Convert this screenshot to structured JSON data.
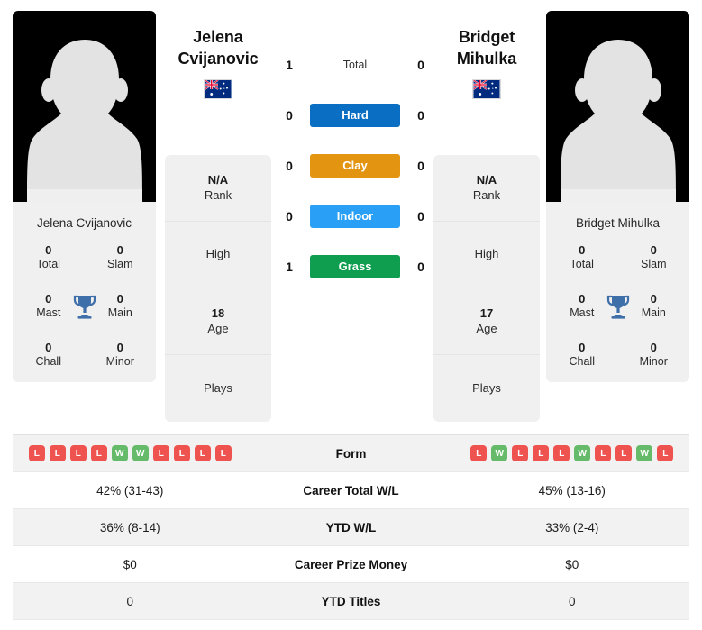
{
  "players": {
    "left": {
      "first_name": "Jelena",
      "last_name": "Cvijanovic",
      "full_name": "Jelena Cvijanovic",
      "flag": "australia-flag",
      "titles": {
        "total_value": "0",
        "total_label": "Total",
        "slam_value": "0",
        "slam_label": "Slam",
        "mast_value": "0",
        "mast_label": "Mast",
        "main_value": "0",
        "main_label": "Main",
        "chall_value": "0",
        "chall_label": "Chall",
        "minor_value": "0",
        "minor_label": "Minor"
      },
      "info": {
        "rank_value": "N/A",
        "rank_label": "Rank",
        "high_value": "",
        "high_label": "High",
        "age_value": "18",
        "age_label": "Age",
        "plays_value": "",
        "plays_label": "Plays"
      },
      "form": [
        "L",
        "L",
        "L",
        "L",
        "W",
        "W",
        "L",
        "L",
        "L",
        "L"
      ],
      "career_total_wl": "42% (31-43)",
      "ytd_wl": "36% (8-14)",
      "career_prize_money": "$0",
      "ytd_titles": "0"
    },
    "right": {
      "first_name": "Bridget",
      "last_name": "Mihulka",
      "full_name": "Bridget Mihulka",
      "flag": "australia-flag",
      "titles": {
        "total_value": "0",
        "total_label": "Total",
        "slam_value": "0",
        "slam_label": "Slam",
        "mast_value": "0",
        "mast_label": "Mast",
        "main_value": "0",
        "main_label": "Main",
        "chall_value": "0",
        "chall_label": "Chall",
        "minor_value": "0",
        "minor_label": "Minor"
      },
      "info": {
        "rank_value": "N/A",
        "rank_label": "Rank",
        "high_value": "",
        "high_label": "High",
        "age_value": "17",
        "age_label": "Age",
        "plays_value": "",
        "plays_label": "Plays"
      },
      "form": [
        "L",
        "W",
        "L",
        "L",
        "L",
        "W",
        "L",
        "L",
        "W",
        "L"
      ],
      "career_total_wl": "45% (13-16)",
      "ytd_wl": "33% (2-4)",
      "career_prize_money": "$0",
      "ytd_titles": "0"
    }
  },
  "head_to_head": [
    {
      "label": "Total",
      "left": "1",
      "right": "0",
      "badge": false,
      "color": ""
    },
    {
      "label": "Hard",
      "left": "0",
      "right": "0",
      "badge": true,
      "color": "#0a6fc2"
    },
    {
      "label": "Clay",
      "left": "0",
      "right": "0",
      "badge": true,
      "color": "#e39410"
    },
    {
      "label": "Indoor",
      "left": "0",
      "right": "0",
      "badge": true,
      "color": "#29a0f5"
    },
    {
      "label": "Grass",
      "left": "1",
      "right": "0",
      "badge": true,
      "color": "#0f9d4f"
    }
  ],
  "comparison_rows": [
    {
      "label": "Form",
      "type": "form"
    },
    {
      "label": "Career Total W/L",
      "type": "text",
      "key": "career_total_wl"
    },
    {
      "label": "YTD W/L",
      "type": "text",
      "key": "ytd_wl"
    },
    {
      "label": "Career Prize Money",
      "type": "text",
      "key": "career_prize_money"
    },
    {
      "label": "YTD Titles",
      "type": "text",
      "key": "ytd_titles"
    }
  ],
  "colors": {
    "win": "#66bb6a",
    "loss": "#ef5350",
    "card_bg": "#f0f0f0",
    "row_alt": "#f2f2f2",
    "trophy": "#3f6fa8"
  }
}
